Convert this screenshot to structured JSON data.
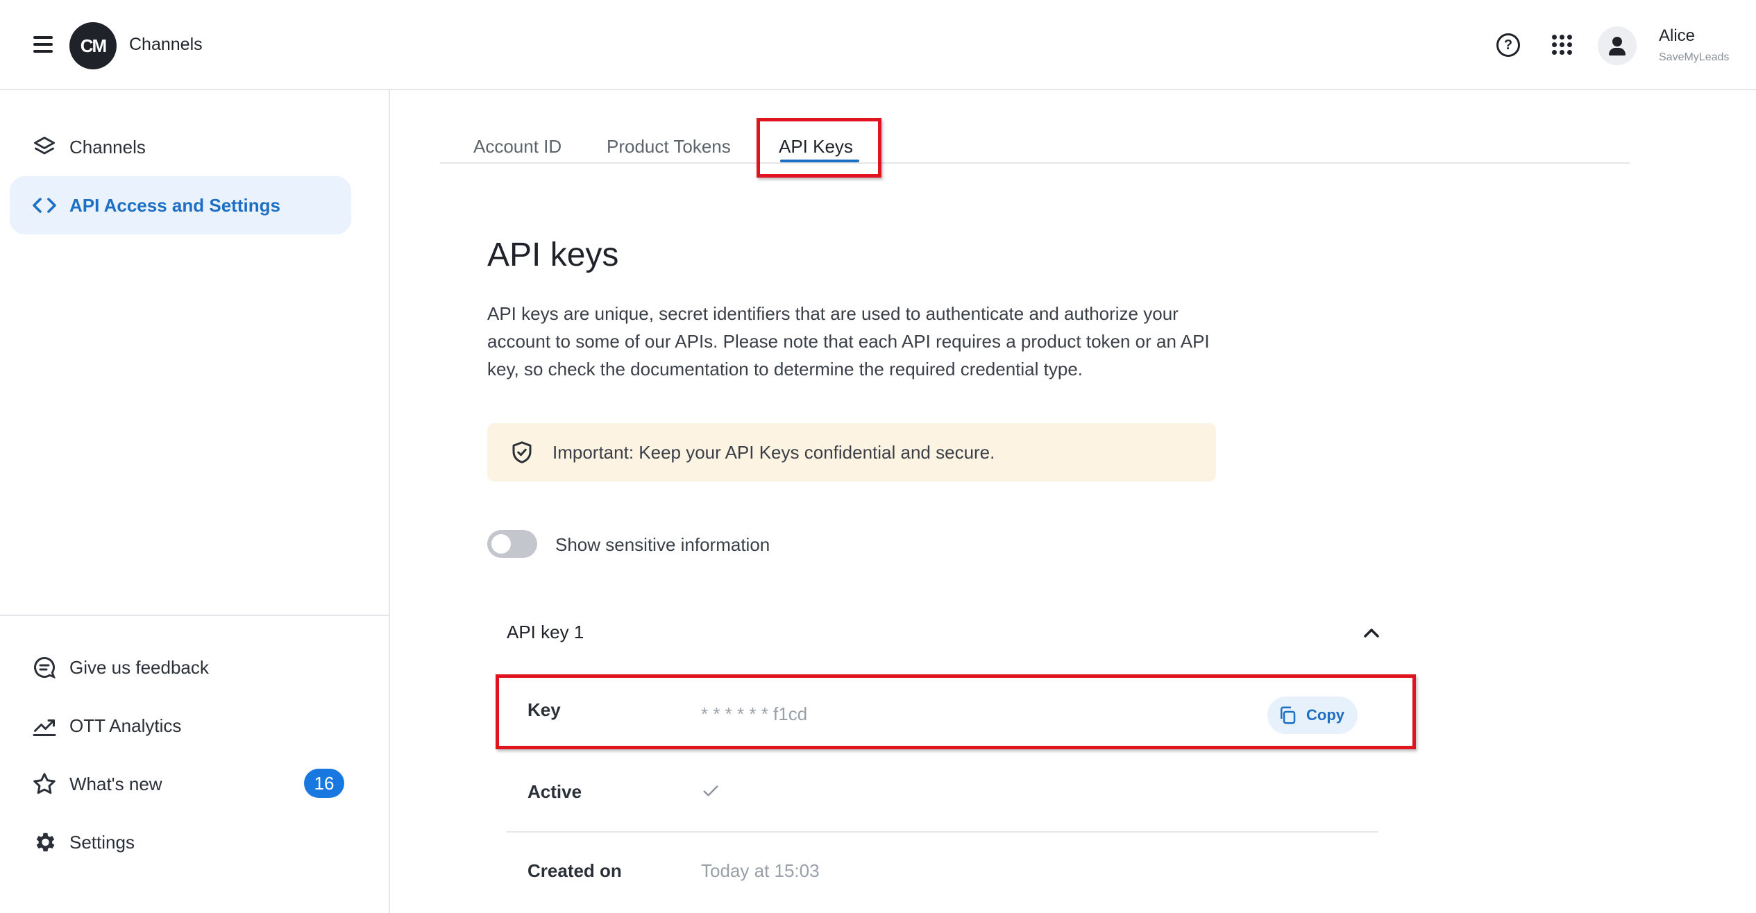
{
  "header": {
    "logo_text": "CM",
    "app_title": "Channels",
    "user_name": "Alice",
    "user_org": "SaveMyLeads"
  },
  "sidebar": {
    "items": [
      {
        "label": "Channels",
        "icon": "layers-icon",
        "active": false
      },
      {
        "label": "API Access and Settings",
        "icon": "code-icon",
        "active": true
      }
    ],
    "bottom_items": [
      {
        "label": "Give us feedback",
        "icon": "chat-icon"
      },
      {
        "label": "OTT Analytics",
        "icon": "trend-icon"
      },
      {
        "label": "What's new",
        "icon": "star-icon",
        "badge": "16"
      },
      {
        "label": "Settings",
        "icon": "gear-icon"
      }
    ]
  },
  "tabs": [
    {
      "label": "Account ID"
    },
    {
      "label": "Product Tokens"
    },
    {
      "label": "API Keys",
      "active": true
    }
  ],
  "main": {
    "title": "API keys",
    "description": "API keys are unique, secret identifiers that are used to authenticate and authorize your account to some of our APIs. Please note that each API requires a product token or an API key, so check the documentation to determine the required credential type.",
    "alert": "Important: Keep your API Keys confidential and secure.",
    "toggle_label": "Show sensitive information",
    "toggle_on": false
  },
  "api_key": {
    "title": "API key 1",
    "rows": {
      "key_label": "Key",
      "key_value": "* * * * * * f1cd",
      "copy_label": "Copy",
      "active_label": "Active",
      "created_label": "Created on",
      "created_value": "Today at 15:03"
    }
  },
  "colors": {
    "accent": "#1d6fc4",
    "highlight": "#e0141e",
    "alert_bg": "#fdf3e2",
    "badge": "#1878e0"
  }
}
